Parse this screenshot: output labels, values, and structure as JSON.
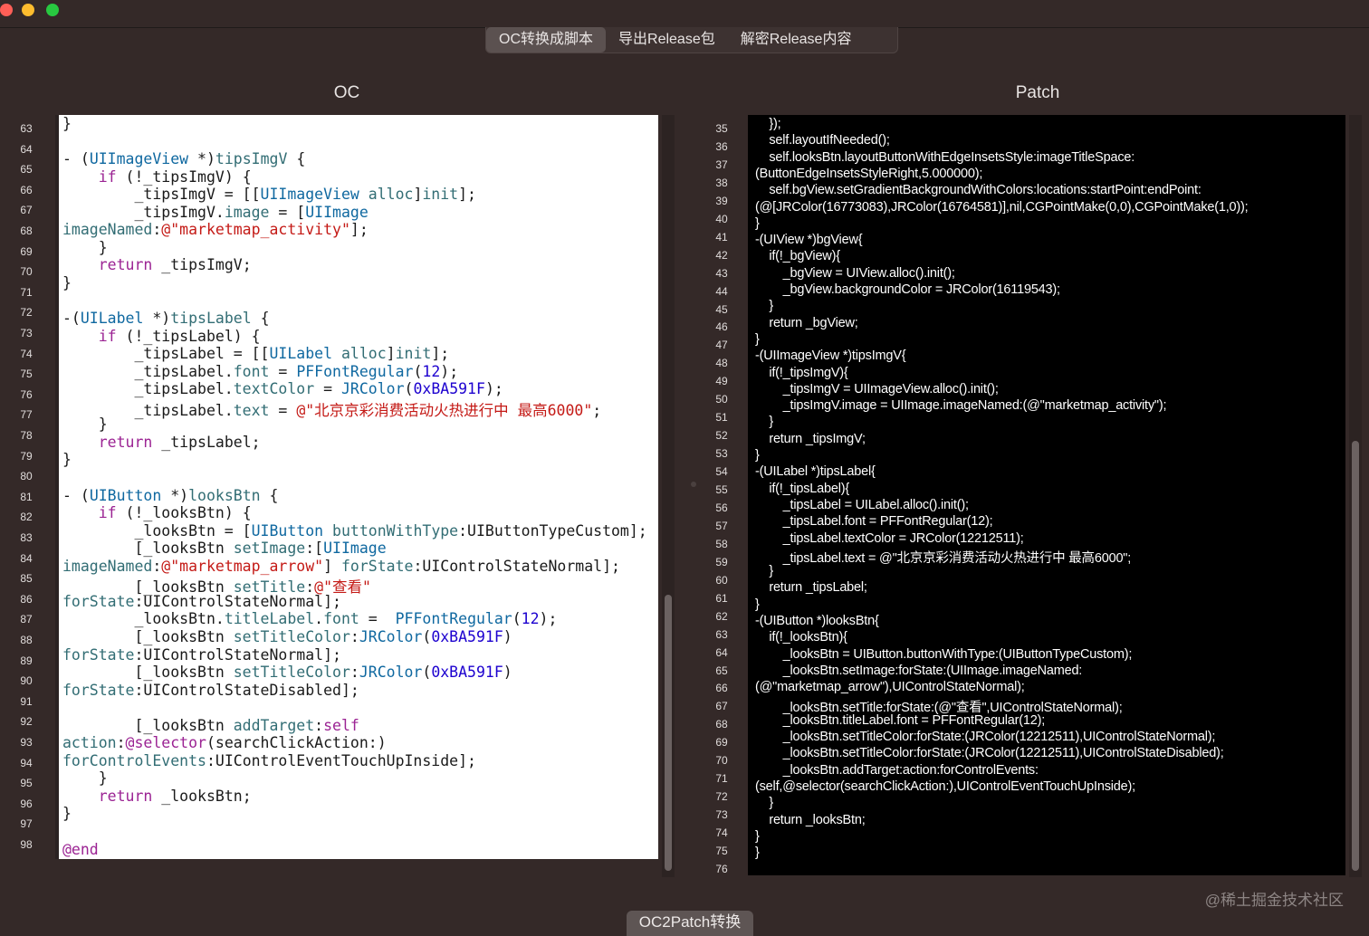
{
  "tabs": [
    {
      "label": "OC转换成脚本",
      "active": true
    },
    {
      "label": "导出Release包",
      "active": false
    },
    {
      "label": "解密Release内容",
      "active": false
    }
  ],
  "panels": {
    "left_title": "OC",
    "right_title": "Patch"
  },
  "oc_line_numbers": [
    "63",
    "64",
    "65",
    "66",
    "67",
    "68",
    "69",
    "70",
    "71",
    "72",
    "73",
    "74",
    "75",
    "76",
    "77",
    "78",
    "79",
    "80",
    "81",
    "82",
    "83",
    "84",
    "85",
    "86",
    "87",
    "88",
    "89",
    "90",
    "91",
    "92",
    "93",
    "94",
    "95",
    "96",
    "97",
    "98"
  ],
  "oc_code": [
    "}",
    "",
    "- (UIImageView *)tipsImgV {",
    "    if (!_tipsImgV) {",
    "        _tipsImgV = [[UIImageView alloc]init];",
    "        _tipsImgV.image = [UIImage",
    "imageNamed:@\"marketmap_activity\"];",
    "    }",
    "    return _tipsImgV;",
    "}",
    "",
    "-(UILabel *)tipsLabel {",
    "    if (!_tipsLabel) {",
    "        _tipsLabel = [[UILabel alloc]init];",
    "        _tipsLabel.font = PFFontRegular(12);",
    "        _tipsLabel.textColor = JRColor(0xBA591F);",
    "        _tipsLabel.text = @\"北京京彩消费活动火热进行中 最高6000\";",
    "    }",
    "    return _tipsLabel;",
    "}",
    "",
    "- (UIButton *)looksBtn {",
    "    if (!_looksBtn) {",
    "        _looksBtn = [UIButton buttonWithType:UIButtonTypeCustom];",
    "        [_looksBtn setImage:[UIImage",
    "imageNamed:@\"marketmap_arrow\"] forState:UIControlStateNormal];",
    "        [_looksBtn setTitle:@\"查看\"",
    "forState:UIControlStateNormal];",
    "        _looksBtn.titleLabel.font =  PFFontRegular(12);",
    "        [_looksBtn setTitleColor:JRColor(0xBA591F)",
    "forState:UIControlStateNormal];",
    "        [_looksBtn setTitleColor:JRColor(0xBA591F)",
    "forState:UIControlStateDisabled];",
    "",
    "        [_looksBtn addTarget:self",
    "action:@selector(searchClickAction:)",
    "forControlEvents:UIControlEventTouchUpInside];",
    "    }",
    "    return _looksBtn;",
    "}",
    "",
    "@end"
  ],
  "patch_line_numbers": [
    "35",
    "36",
    "37",
    "38",
    "39",
    "40",
    "41",
    "42",
    "43",
    "44",
    "45",
    "46",
    "47",
    "48",
    "49",
    "50",
    "51",
    "52",
    "53",
    "54",
    "55",
    "56",
    "57",
    "58",
    "59",
    "60",
    "61",
    "62",
    "63",
    "64",
    "65",
    "66",
    "67",
    "68",
    "69",
    "70",
    "71",
    "72",
    "73",
    "74",
    "75",
    "76"
  ],
  "patch_code": [
    "    });",
    "    self.layoutIfNeeded();",
    "    self.looksBtn.layoutButtonWithEdgeInsetsStyle:imageTitleSpace:",
    "(ButtonEdgeInsetsStyleRight,5.000000);",
    "    self.bgView.setGradientBackgroundWithColors:locations:startPoint:endPoint:",
    "(@[JRColor(16773083),JRColor(16764581)],nil,CGPointMake(0,0),CGPointMake(1,0));",
    "}",
    "-(UIView *)bgView{",
    "    if(!_bgView){",
    "        _bgView = UIView.alloc().init();",
    "        _bgView.backgroundColor = JRColor(16119543);",
    "    }",
    "    return _bgView;",
    "}",
    "-(UIImageView *)tipsImgV{",
    "    if(!_tipsImgV){",
    "        _tipsImgV = UIImageView.alloc().init();",
    "        _tipsImgV.image = UIImage.imageNamed:(@\"marketmap_activity\");",
    "    }",
    "    return _tipsImgV;",
    "}",
    "-(UILabel *)tipsLabel{",
    "    if(!_tipsLabel){",
    "        _tipsLabel = UILabel.alloc().init();",
    "        _tipsLabel.font = PFFontRegular(12);",
    "        _tipsLabel.textColor = JRColor(12212511);",
    "        _tipsLabel.text = @\"北京京彩消费活动火热进行中 最高6000\";",
    "    }",
    "    return _tipsLabel;",
    "}",
    "-(UIButton *)looksBtn{",
    "    if(!_looksBtn){",
    "        _looksBtn = UIButton.buttonWithType:(UIButtonTypeCustom);",
    "        _looksBtn.setImage:forState:(UIImage.imageNamed:",
    "(@\"marketmap_arrow\"),UIControlStateNormal);",
    "        _looksBtn.setTitle:forState:(@\"查看\",UIControlStateNormal);",
    "        _looksBtn.titleLabel.font = PFFontRegular(12);",
    "        _looksBtn.setTitleColor:forState:(JRColor(12212511),UIControlStateNormal);",
    "        _looksBtn.setTitleColor:forState:(JRColor(12212511),UIControlStateDisabled);",
    "        _looksBtn.addTarget:action:forControlEvents:",
    "(self,@selector(searchClickAction:),UIControlEventTouchUpInside);",
    "    }",
    "    return _looksBtn;",
    "}",
    "}"
  ],
  "bottom_button": "OC2Patch转换",
  "watermark": "@稀土掘金技术社区"
}
